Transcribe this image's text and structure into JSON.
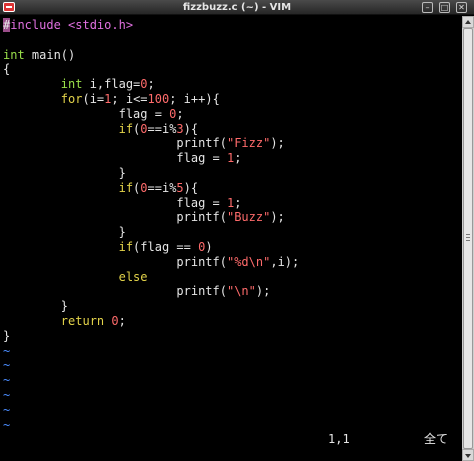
{
  "window": {
    "title": "fizzbuzz.c (~) - VIM",
    "minimize_glyph": "–",
    "maximize_glyph": "□",
    "close_glyph": "✕"
  },
  "editor": {
    "lines": [
      {
        "segments": [
          {
            "cls": "cursor-char",
            "text": "#"
          },
          {
            "cls": "c-pre",
            "text": "include <stdio.h>"
          }
        ]
      },
      {
        "segments": []
      },
      {
        "segments": [
          {
            "cls": "c-type",
            "text": "int"
          },
          {
            "cls": "",
            "text": " main()"
          }
        ]
      },
      {
        "segments": [
          {
            "cls": "",
            "text": "{"
          }
        ]
      },
      {
        "segments": [
          {
            "cls": "",
            "text": "        "
          },
          {
            "cls": "c-type",
            "text": "int"
          },
          {
            "cls": "",
            "text": " i,flag="
          },
          {
            "cls": "c-num",
            "text": "0"
          },
          {
            "cls": "",
            "text": ";"
          }
        ]
      },
      {
        "segments": [
          {
            "cls": "",
            "text": "        "
          },
          {
            "cls": "c-stat",
            "text": "for"
          },
          {
            "cls": "",
            "text": "(i="
          },
          {
            "cls": "c-num",
            "text": "1"
          },
          {
            "cls": "",
            "text": "; i<="
          },
          {
            "cls": "c-num",
            "text": "100"
          },
          {
            "cls": "",
            "text": "; i++){"
          }
        ]
      },
      {
        "segments": [
          {
            "cls": "",
            "text": "                flag = "
          },
          {
            "cls": "c-num",
            "text": "0"
          },
          {
            "cls": "",
            "text": ";"
          }
        ]
      },
      {
        "segments": [
          {
            "cls": "",
            "text": "                "
          },
          {
            "cls": "c-stat",
            "text": "if"
          },
          {
            "cls": "",
            "text": "("
          },
          {
            "cls": "c-num",
            "text": "0"
          },
          {
            "cls": "",
            "text": "==i%"
          },
          {
            "cls": "c-num",
            "text": "3"
          },
          {
            "cls": "",
            "text": "){"
          }
        ]
      },
      {
        "segments": [
          {
            "cls": "",
            "text": "                        printf("
          },
          {
            "cls": "c-str",
            "text": "\"Fizz\""
          },
          {
            "cls": "",
            "text": ");"
          }
        ]
      },
      {
        "segments": [
          {
            "cls": "",
            "text": "                        flag = "
          },
          {
            "cls": "c-num",
            "text": "1"
          },
          {
            "cls": "",
            "text": ";"
          }
        ]
      },
      {
        "segments": [
          {
            "cls": "",
            "text": "                }"
          }
        ]
      },
      {
        "segments": [
          {
            "cls": "",
            "text": "                "
          },
          {
            "cls": "c-stat",
            "text": "if"
          },
          {
            "cls": "",
            "text": "("
          },
          {
            "cls": "c-num",
            "text": "0"
          },
          {
            "cls": "",
            "text": "==i%"
          },
          {
            "cls": "c-num",
            "text": "5"
          },
          {
            "cls": "",
            "text": "){"
          }
        ]
      },
      {
        "segments": [
          {
            "cls": "",
            "text": "                        flag = "
          },
          {
            "cls": "c-num",
            "text": "1"
          },
          {
            "cls": "",
            "text": ";"
          }
        ]
      },
      {
        "segments": [
          {
            "cls": "",
            "text": "                        printf("
          },
          {
            "cls": "c-str",
            "text": "\"Buzz\""
          },
          {
            "cls": "",
            "text": ");"
          }
        ]
      },
      {
        "segments": [
          {
            "cls": "",
            "text": "                }"
          }
        ]
      },
      {
        "segments": [
          {
            "cls": "",
            "text": "                "
          },
          {
            "cls": "c-stat",
            "text": "if"
          },
          {
            "cls": "",
            "text": "(flag == "
          },
          {
            "cls": "c-num",
            "text": "0"
          },
          {
            "cls": "",
            "text": ")"
          }
        ]
      },
      {
        "segments": [
          {
            "cls": "",
            "text": "                        printf("
          },
          {
            "cls": "c-str",
            "text": "\""
          },
          {
            "cls": "c-spec",
            "text": "%d\\n"
          },
          {
            "cls": "c-str",
            "text": "\""
          },
          {
            "cls": "",
            "text": ",i);"
          }
        ]
      },
      {
        "segments": [
          {
            "cls": "",
            "text": "                "
          },
          {
            "cls": "c-stat",
            "text": "else"
          }
        ]
      },
      {
        "segments": [
          {
            "cls": "",
            "text": "                        printf("
          },
          {
            "cls": "c-str",
            "text": "\""
          },
          {
            "cls": "c-spec",
            "text": "\\n"
          },
          {
            "cls": "c-str",
            "text": "\""
          },
          {
            "cls": "",
            "text": ");"
          }
        ]
      },
      {
        "segments": [
          {
            "cls": "",
            "text": "        }"
          }
        ]
      },
      {
        "segments": [
          {
            "cls": "",
            "text": "        "
          },
          {
            "cls": "c-stat",
            "text": "return"
          },
          {
            "cls": "",
            "text": " "
          },
          {
            "cls": "c-num",
            "text": "0"
          },
          {
            "cls": "",
            "text": ";"
          }
        ]
      },
      {
        "segments": [
          {
            "cls": "",
            "text": "}"
          }
        ]
      }
    ],
    "tilde_rows": [
      "~",
      "~",
      "~",
      "~",
      "~",
      "~"
    ]
  },
  "status": {
    "position": "1,1",
    "scroll": "全て"
  },
  "colors": {
    "preprocessor": "#e070e0",
    "type": "#9ae04a",
    "statement": "#e3d34a",
    "constant": "#ff6b6b",
    "nontext": "#4a8cff",
    "cursor": "#9b4e8a"
  }
}
